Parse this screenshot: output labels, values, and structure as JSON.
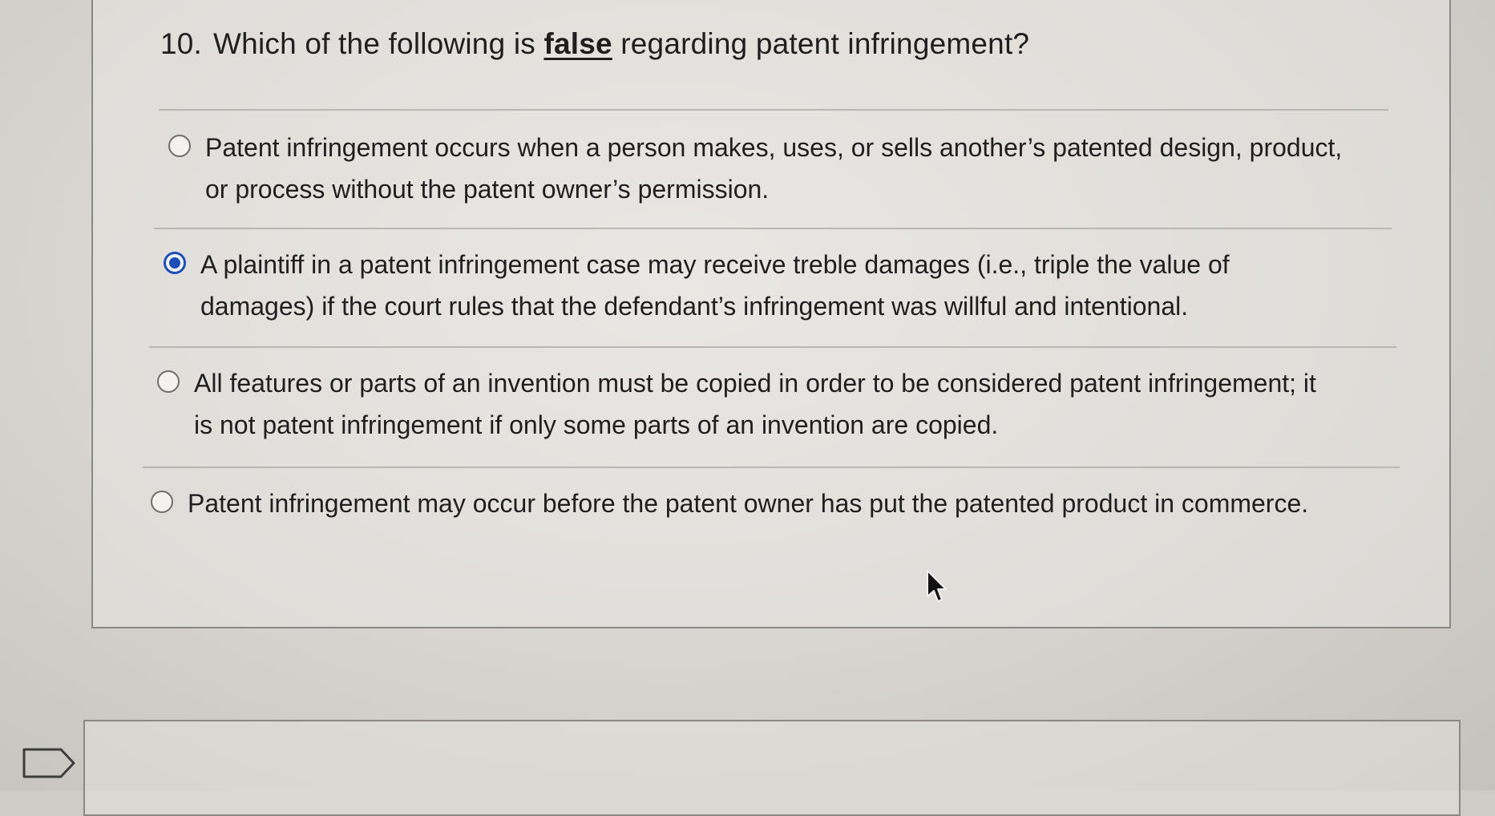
{
  "question": {
    "number": "10.",
    "text_before": "Which of the following is ",
    "emphasis": "false",
    "text_after": " regarding patent infringement?"
  },
  "options": [
    {
      "text": "Patent infringement occurs when a person makes, uses, or sells another’s patented design, product, or process without the patent owner’s permission.",
      "selected": false
    },
    {
      "text": "A plaintiff in a patent infringement case may receive treble damages (i.e., triple the value of damages) if the court rules that the defendant’s infringement was willful and intentional.",
      "selected": true
    },
    {
      "text": "All features or parts of an invention must be copied in order to be considered patent infringement; it is not patent infringement if only some parts of an invention are copied.",
      "selected": false
    },
    {
      "text": "Patent infringement may occur before the patent owner has put the patented product in commerce.",
      "selected": false
    }
  ],
  "icons": {
    "answer_tag": "tag-outline-icon",
    "cursor": "mouse-pointer-icon",
    "radio_selected_color": "#1d4fb8"
  }
}
